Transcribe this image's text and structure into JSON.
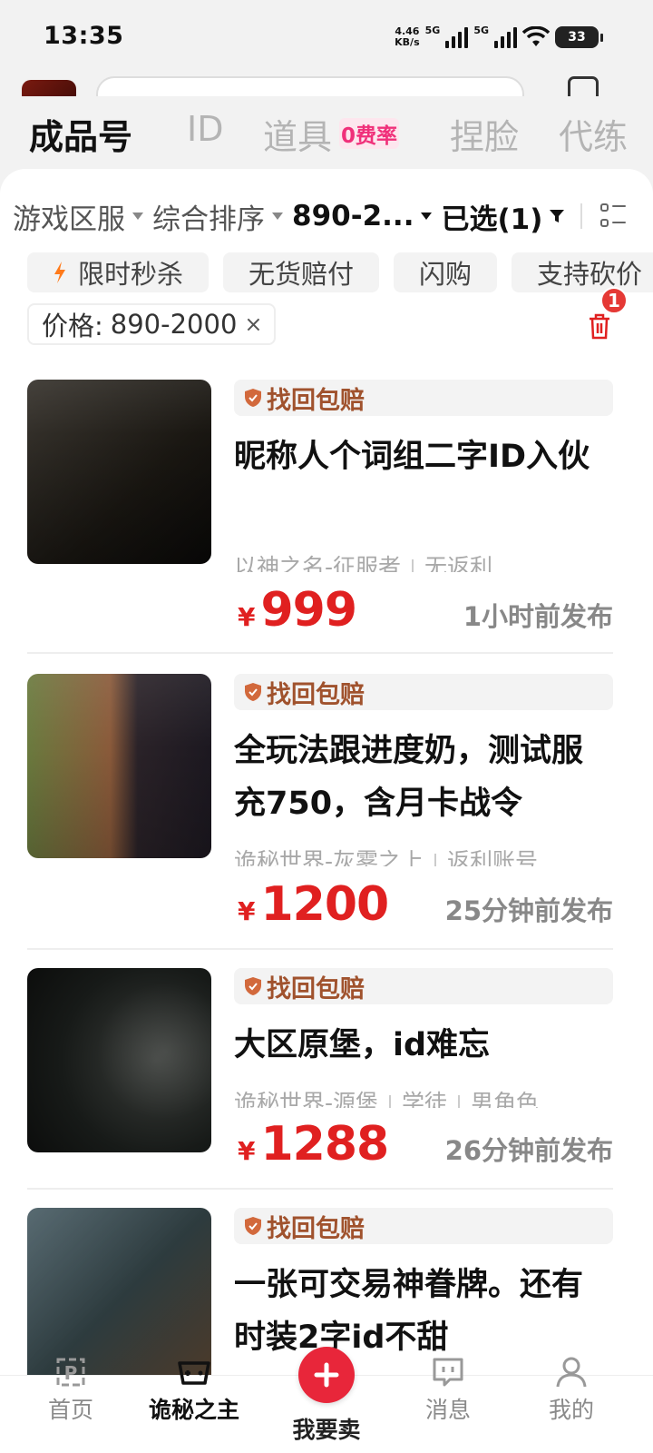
{
  "status_bar": {
    "time": "13:35",
    "net_speed": "4.46",
    "net_speed_unit": "KB/s",
    "network_1": "5G",
    "network_2": "5G",
    "battery": "33"
  },
  "category_tabs": [
    {
      "label": "成品号",
      "active": true
    },
    {
      "label": "ID",
      "active": false
    },
    {
      "label": "道具",
      "active": false
    },
    {
      "label": "捏脸",
      "active": false
    },
    {
      "label": "代练",
      "active": false
    }
  ],
  "fee_badge": "0费率",
  "filters": [
    {
      "label": "游戏区服"
    },
    {
      "label": "综合排序"
    },
    {
      "label": "890-2..."
    },
    {
      "label": "已选(1)"
    }
  ],
  "tags": [
    "限时秒杀",
    "无货赔付",
    "闪购",
    "支持砍价"
  ],
  "active_filter": {
    "label": "价格:",
    "value": "890-2000",
    "remove": "×"
  },
  "selected_count_badge": "1",
  "listings": [
    {
      "guarantee": "找回包赔",
      "title": "昵称人个词组二字ID入伙",
      "meta": [
        "以神之名-征服者",
        "无返利"
      ],
      "currency": "¥",
      "price": "999",
      "posted": "1小时前发布"
    },
    {
      "guarantee": "找回包赔",
      "title": "全玩法跟进度奶，测试服充750，含月卡战令",
      "meta": [
        "诡秘世界-灰雾之上",
        "返利账号"
      ],
      "currency": "¥",
      "price": "1200",
      "posted": "25分钟前发布"
    },
    {
      "guarantee": "找回包赔",
      "title": "大区原堡，id难忘",
      "meta": [
        "诡秘世界-源堡",
        "学徒",
        "男角色"
      ],
      "currency": "¥",
      "price": "1288",
      "posted": "26分钟前发布"
    },
    {
      "guarantee": "找回包赔",
      "title": "一张可交易神眷牌。还有时装2字id不甜",
      "meta": [],
      "currency": "¥",
      "price": "",
      "posted": ""
    }
  ],
  "bottom_nav": {
    "home": "首页",
    "game": "诡秘之主",
    "sell": "我要卖",
    "messages": "消息",
    "mine": "我的"
  },
  "colors": {
    "accent_red": "#e02020",
    "guarantee_brown": "#a0522d",
    "fee_pink": "#f0307a",
    "sell_button": "#e8263a"
  },
  "icons": [
    "lightning-icon",
    "shield-icon",
    "trash-icon",
    "grid-view-icon",
    "home-icon",
    "gamepad-icon",
    "plus-icon",
    "message-icon",
    "user-icon"
  ]
}
